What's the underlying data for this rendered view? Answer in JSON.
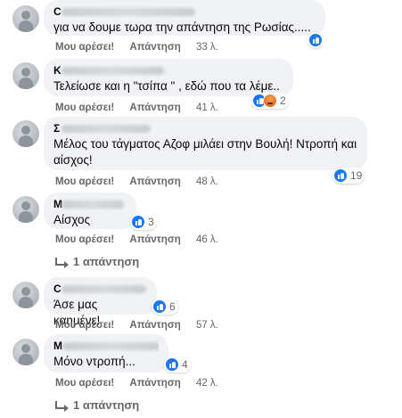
{
  "action_labels": {
    "like": "Μου αρέσει!",
    "reply": "Απάντηση"
  },
  "comments": [
    {
      "author_visible": "C",
      "text": "για να δουμε τωρα την απάντηση της Ρωσίας.....",
      "time": "33 λ.",
      "reaction_count": "",
      "reactions": [
        "like-icon"
      ]
    },
    {
      "author_visible": "Κ",
      "text": "Τελείωσε και η \"τσίπα \" , εδώ που τα λέμε..",
      "time": "41 λ.",
      "reaction_count": "2",
      "reactions": [
        "like-icon",
        "angry-icon"
      ]
    },
    {
      "author_visible": "Σ",
      "text": "Μέλος του τάγματος Αζοφ μιλάει στην Βουλή! Ντροπή και αίσχος!",
      "time": "48 λ.",
      "reaction_count": "19",
      "reactions": [
        "like-icon"
      ]
    },
    {
      "author_visible": "Μ",
      "text": "Αίσχος",
      "time": "46 λ.",
      "reaction_count": "3",
      "reactions": [
        "like-icon"
      ],
      "replies": "1 απάντηση"
    },
    {
      "author_visible": "C",
      "text": "Άσε μας καημένε!",
      "time": "57 λ.",
      "reaction_count": "6",
      "reactions": [
        "like-icon"
      ]
    },
    {
      "author_visible": "M",
      "text": "Μόνο ντροπή...",
      "time": "42 λ.",
      "reaction_count": "4",
      "reactions": [
        "like-icon"
      ],
      "replies": "1 απάντηση"
    }
  ],
  "colors": {
    "like_blue": "#1877f2",
    "bubble_bg": "#f0f2f5",
    "meta_gray": "#65676b"
  }
}
